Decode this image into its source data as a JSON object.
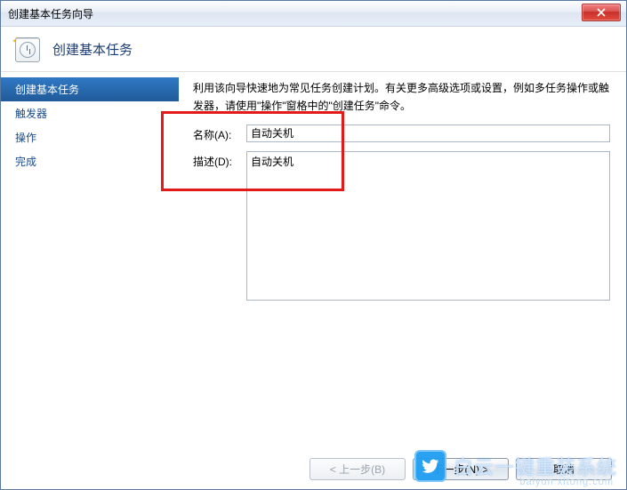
{
  "window": {
    "title": "创建基本任务向导"
  },
  "header": {
    "title": "创建基本任务"
  },
  "sidebar": {
    "items": [
      {
        "label": "创建基本任务",
        "active": true
      },
      {
        "label": "触发器",
        "active": false
      },
      {
        "label": "操作",
        "active": false
      },
      {
        "label": "完成",
        "active": false
      }
    ]
  },
  "content": {
    "intro": "利用该向导快速地为常见任务创建计划。有关更多高级选项或设置，例如多任务操作或触发器，请使用\"操作\"窗格中的\"创建任务\"命令。",
    "name_label": "名称(A):",
    "name_value": "自动关机",
    "desc_label": "描述(D):",
    "desc_value": "自动关机"
  },
  "footer": {
    "back": "< 上一步(B)",
    "next": "下一步(N) >",
    "cancel": "取消"
  },
  "watermark": {
    "text": "白云一键重装系统",
    "sub": "baiyun xitong.com"
  }
}
